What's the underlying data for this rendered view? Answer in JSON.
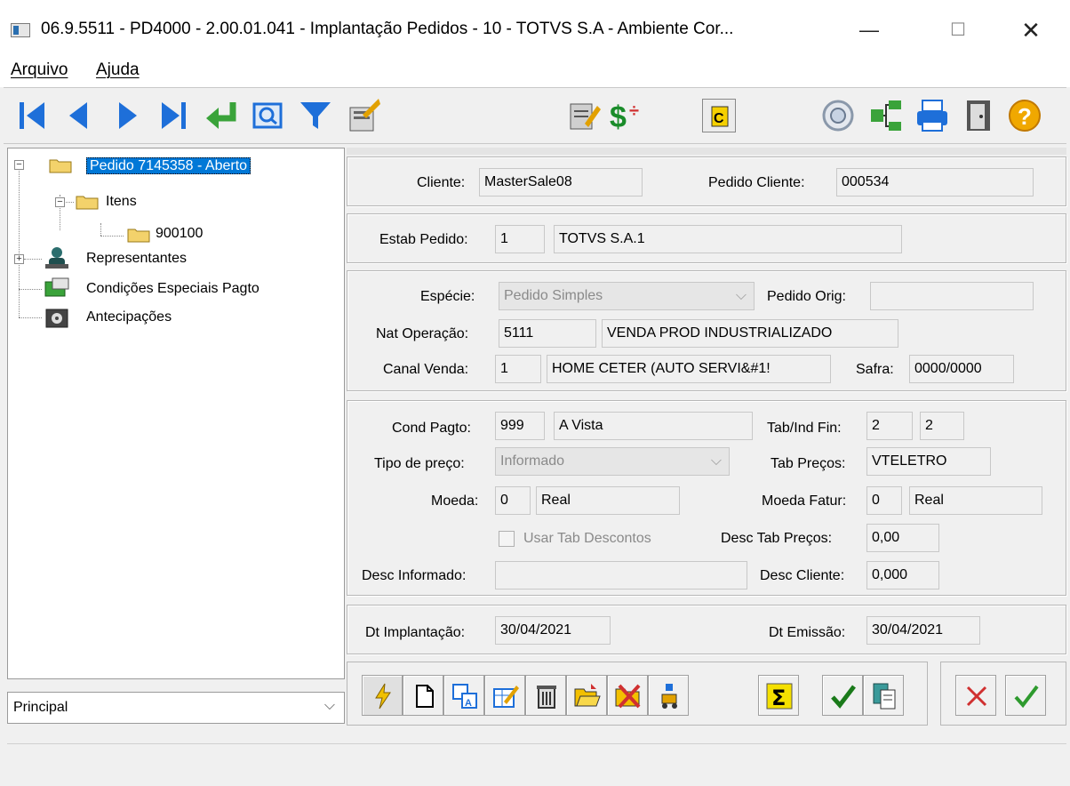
{
  "window": {
    "title": "06.9.5511 - PD4000 - 2.00.01.041 - Implantação Pedidos - 10 - TOTVS S.A - Ambiente Cor...",
    "minimize": "—",
    "maximize": "☐",
    "close": "✕"
  },
  "menu": {
    "arquivo": "Arquivo",
    "ajuda": "Ajuda"
  },
  "tree": {
    "pedido": "Pedido 7145358 - Aberto",
    "itens": "Itens",
    "item_900100": "900100",
    "representantes": "Representantes",
    "condicoes": "Condições Especiais Pagto",
    "antecipacoes": "Antecipações",
    "expand_minus": "−",
    "expand_plus": "+"
  },
  "view_select": {
    "value": "Principal",
    "arrow": "⌵"
  },
  "cliente_group": {
    "cliente_label": "Cliente:",
    "cliente_value": "MasterSale08",
    "pedido_cliente_label": "Pedido Cliente:",
    "pedido_cliente_value": "000534"
  },
  "estab_group": {
    "estab_label": "Estab Pedido:",
    "estab_code": "1",
    "estab_name": "TOTVS S.A.1"
  },
  "especie_group": {
    "especie_label": "Espécie:",
    "especie_value": "Pedido Simples",
    "pedido_orig_label": "Pedido Orig:",
    "pedido_orig_value": "",
    "nat_operacao_label": "Nat Operação:",
    "nat_operacao_code": "5111",
    "nat_operacao_desc": "VENDA PROD INDUSTRIALIZADO",
    "canal_venda_label": "Canal Venda:",
    "canal_venda_code": "1",
    "canal_venda_desc": "HOME CETER (AUTO SERVI&#1!",
    "safra_label": "Safra:",
    "safra_value": "0000/0000"
  },
  "pagto_group": {
    "cond_pagto_label": "Cond Pagto:",
    "cond_pagto_code": "999",
    "cond_pagto_desc": "A Vista",
    "tab_ind_fin_label": "Tab/Ind Fin:",
    "tab_ind_fin_1": "2",
    "tab_ind_fin_2": "2",
    "tipo_preco_label": "Tipo de preço:",
    "tipo_preco_value": "Informado",
    "tab_precos_label": "Tab Preços:",
    "tab_precos_value": "VTELETRO",
    "moeda_label": "Moeda:",
    "moeda_code": "0",
    "moeda_desc": "Real",
    "moeda_fatur_label": "Moeda Fatur:",
    "moeda_fatur_code": "0",
    "moeda_fatur_desc": "Real",
    "usar_tab_descontos_label": "Usar Tab Descontos",
    "desc_tab_precos_label": "Desc Tab Preços:",
    "desc_tab_precos_value": "0,00",
    "desc_informado_label": "Desc Informado:",
    "desc_informado_value": "",
    "desc_cliente_label": "Desc Cliente:",
    "desc_cliente_value": "0,000"
  },
  "datas_group": {
    "dt_implantacao_label": "Dt Implantação:",
    "dt_implantacao_value": "30/04/2021",
    "dt_emissao_label": "Dt Emissão:",
    "dt_emissao_value": "30/04/2021"
  },
  "colors": {
    "selection": "#0078d7",
    "nav_blue": "#1e6fd9",
    "folder_yellow": "#f3d26b",
    "ok_green": "#2e9a2e",
    "cancel_red": "#d03030"
  }
}
